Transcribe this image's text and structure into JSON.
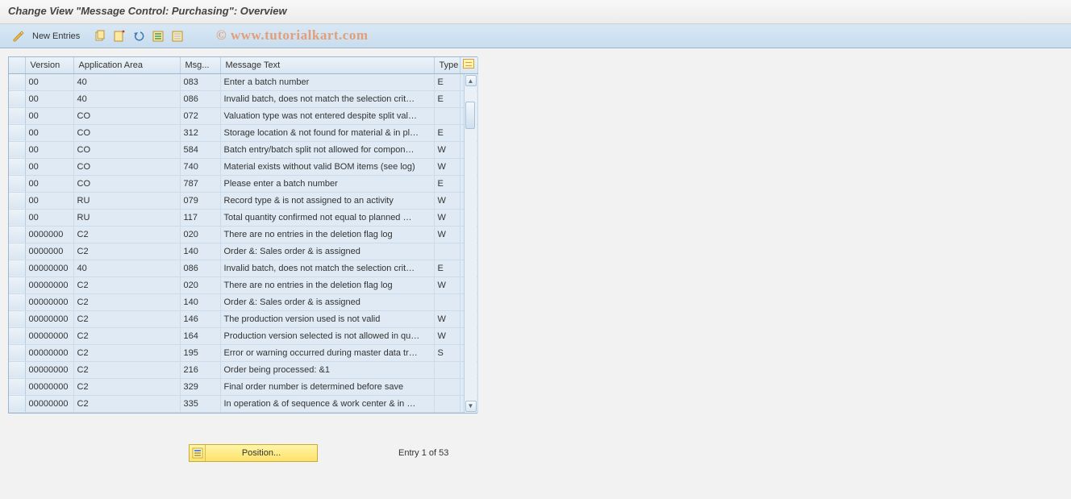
{
  "title": "Change View \"Message Control: Purchasing\": Overview",
  "toolbar": {
    "new_entries": "New Entries"
  },
  "watermark": "© www.tutorialkart.com",
  "table": {
    "columns": {
      "version": "Version",
      "app_area": "Application Area",
      "msg": "Msg...",
      "msg_text": "Message Text",
      "type": "Type"
    },
    "rows": [
      {
        "version": "00",
        "app": "40",
        "msg": "083",
        "text": "Enter a batch number",
        "type": "E"
      },
      {
        "version": "00",
        "app": "40",
        "msg": "086",
        "text": "Invalid batch, does not match the selection crit…",
        "type": "E"
      },
      {
        "version": "00",
        "app": "CO",
        "msg": "072",
        "text": "Valuation type was not entered despite split val…",
        "type": ""
      },
      {
        "version": "00",
        "app": "CO",
        "msg": "312",
        "text": "Storage location & not found for material & in pl…",
        "type": "E"
      },
      {
        "version": "00",
        "app": "CO",
        "msg": "584",
        "text": "Batch entry/batch split not allowed for compon…",
        "type": "W"
      },
      {
        "version": "00",
        "app": "CO",
        "msg": "740",
        "text": "Material exists without valid BOM items (see log)",
        "type": "W"
      },
      {
        "version": "00",
        "app": "CO",
        "msg": "787",
        "text": "Please enter a batch number",
        "type": "E"
      },
      {
        "version": "00",
        "app": "RU",
        "msg": "079",
        "text": "Record type & is not assigned to an activity",
        "type": "W"
      },
      {
        "version": "00",
        "app": "RU",
        "msg": "117",
        "text": "Total quantity confirmed not equal to planned …",
        "type": "W"
      },
      {
        "version": "0000000",
        "app": "C2",
        "msg": "020",
        "text": "There are no entries in the deletion flag log",
        "type": "W"
      },
      {
        "version": "0000000",
        "app": "C2",
        "msg": "140",
        "text": "Order &: Sales order & is assigned",
        "type": ""
      },
      {
        "version": "00000000",
        "app": "40",
        "msg": "086",
        "text": "Invalid batch, does not match the selection crit…",
        "type": "E"
      },
      {
        "version": "00000000",
        "app": "C2",
        "msg": "020",
        "text": "There are no entries in the deletion flag log",
        "type": "W"
      },
      {
        "version": "00000000",
        "app": "C2",
        "msg": "140",
        "text": "Order &: Sales order & is assigned",
        "type": ""
      },
      {
        "version": "00000000",
        "app": "C2",
        "msg": "146",
        "text": "The production version used is not valid",
        "type": "W"
      },
      {
        "version": "00000000",
        "app": "C2",
        "msg": "164",
        "text": "Production version selected is not allowed in qu…",
        "type": "W"
      },
      {
        "version": "00000000",
        "app": "C2",
        "msg": "195",
        "text": "Error or warning occurred during master data tr…",
        "type": "S"
      },
      {
        "version": "00000000",
        "app": "C2",
        "msg": "216",
        "text": "Order being processed: &1",
        "type": ""
      },
      {
        "version": "00000000",
        "app": "C2",
        "msg": "329",
        "text": "Final order number is determined before save",
        "type": ""
      },
      {
        "version": "00000000",
        "app": "C2",
        "msg": "335",
        "text": "In operation & of sequence & work center & in …",
        "type": ""
      }
    ]
  },
  "footer": {
    "position_btn": "Position...",
    "entry_text": "Entry 1 of 53"
  }
}
